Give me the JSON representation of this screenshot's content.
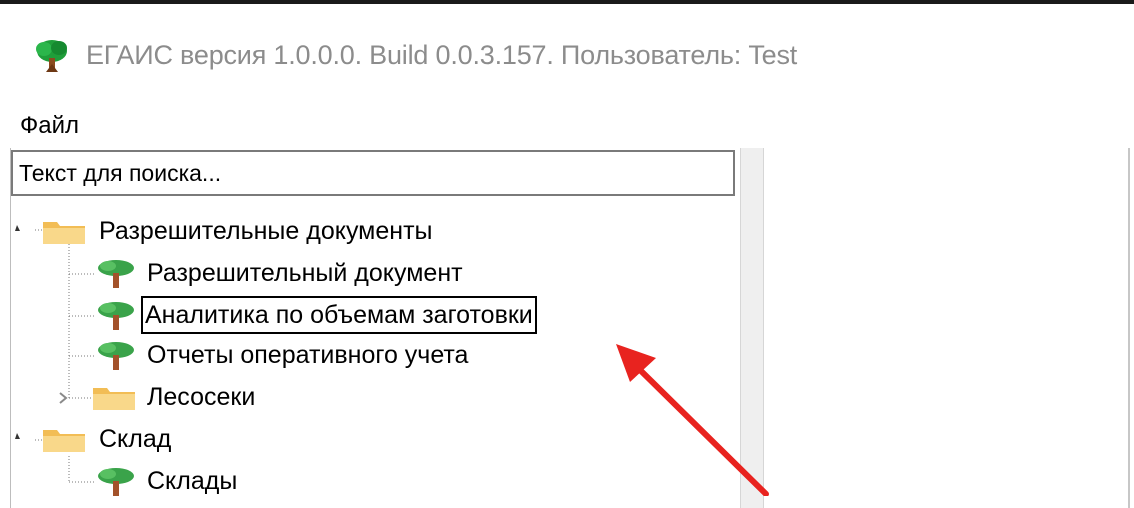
{
  "window": {
    "title": "ЕГАИС версия 1.0.0.0. Build 0.0.3.157. Пользователь: Test",
    "icon": "tree-app-icon"
  },
  "menu": {
    "items": [
      {
        "label": "Файл"
      }
    ]
  },
  "search": {
    "placeholder": "Текст для поиска..."
  },
  "tree": {
    "nodes": [
      {
        "label": "Разрешительные документы",
        "icon": "folder-icon",
        "expanded": true,
        "level": 0
      },
      {
        "label": "Разрешительный документ",
        "icon": "tree-icon",
        "level": 1
      },
      {
        "label": "Аналитика по объемам заготовки",
        "icon": "tree-icon",
        "level": 1,
        "selected": true
      },
      {
        "label": "Отчеты оперативного учета",
        "icon": "tree-icon",
        "level": 1
      },
      {
        "label": "Лесосеки",
        "icon": "folder-icon",
        "expanded": false,
        "level": 1
      },
      {
        "label": "Склад",
        "icon": "folder-icon",
        "expanded": true,
        "level": 0
      },
      {
        "label": "Склады",
        "icon": "tree-icon",
        "level": 1
      }
    ]
  },
  "annotation": {
    "arrow_color": "#e8231f"
  }
}
